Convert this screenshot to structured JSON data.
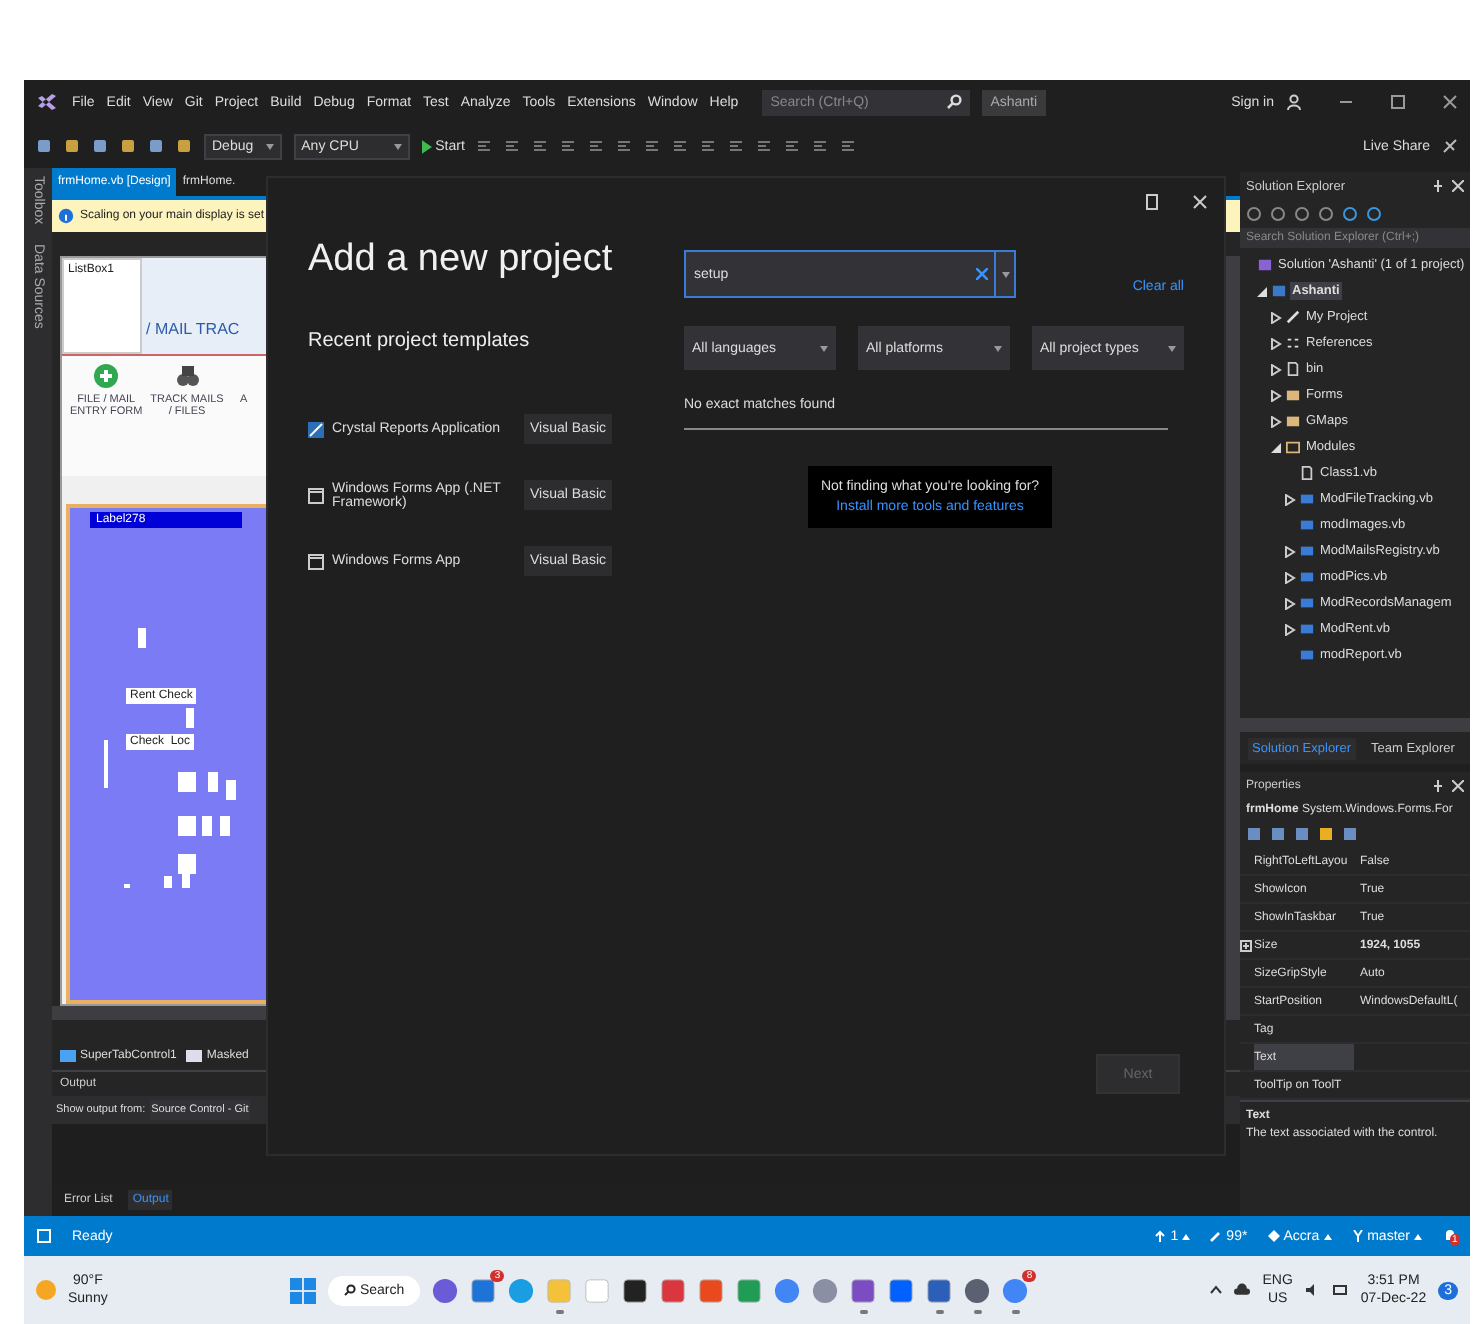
{
  "menu_bar": {
    "items": [
      "File",
      "Edit",
      "View",
      "Git",
      "Project",
      "Build",
      "Debug",
      "Format",
      "Test",
      "Analyze",
      "Tools",
      "Extensions",
      "Window",
      "Help"
    ],
    "search": {
      "placeholder": "Search (Ctrl+Q)"
    },
    "solution_name": "Ashanti",
    "sign_in": "Sign in"
  },
  "toolbar": {
    "configuration": "Debug",
    "platform": "Any CPU",
    "start": "Start",
    "live_share": "Live Share"
  },
  "side_tabs": [
    "Toolbox",
    "Data Sources"
  ],
  "document_tabs": [
    {
      "label": "frmHome.vb [Design]",
      "selected": true
    },
    {
      "label": "frmHome.",
      "selected": false
    }
  ],
  "info_bar": "Scaling on your main display is set",
  "designer": {
    "listbox": "ListBox1",
    "banner": "/ MAIL TRAC",
    "ribbon": [
      {
        "label": "FILE / MAIL\nENTRY FORM",
        "kind": "plus"
      },
      {
        "label": "TRACK MAILS\n/ FILES",
        "kind": "binoculars"
      },
      {
        "label": "A",
        "kind": "none"
      }
    ],
    "label": "Label278",
    "buttons": [
      "Rent Check",
      "Check  Loc"
    ]
  },
  "component_tray": [
    {
      "label": "SuperTabControl1",
      "kind": "tab"
    },
    {
      "label": "Masked",
      "kind": "masked"
    }
  ],
  "output": {
    "title": "Output",
    "show_from_label": "Show output from:",
    "source": "Source Control - Git",
    "tabs": [
      {
        "label": "Error List",
        "selected": false
      },
      {
        "label": "Output",
        "selected": true
      }
    ]
  },
  "dialog": {
    "title": "Add a new project",
    "recent_heading": "Recent project templates",
    "templates": [
      {
        "name": "Crystal Reports Application",
        "language": "Visual Basic",
        "kind": "crystal"
      },
      {
        "name": "Windows Forms App (.NET Framework)",
        "language": "Visual Basic",
        "kind": "window"
      },
      {
        "name": "Windows Forms App",
        "language": "Visual Basic",
        "kind": "window"
      }
    ],
    "search": {
      "value": "setup"
    },
    "clear_all": "Clear all",
    "filters": [
      "All languages",
      "All platforms",
      "All project types"
    ],
    "result_message": "No exact matches found",
    "hint": {
      "question": "Not finding what you're looking for?",
      "link": "Install more tools and features"
    },
    "next_button": {
      "label": "Next",
      "disabled": true
    }
  },
  "solution_explorer": {
    "title": "Solution Explorer",
    "search": {
      "placeholder": "Search Solution Explorer (Ctrl+;)"
    },
    "tree": [
      {
        "label": "Solution 'Ashanti' (1 of 1 project)",
        "kind": "solution",
        "selected": false,
        "children": [
          {
            "label": "Ashanti",
            "kind": "project",
            "expanded": true,
            "selected": true,
            "children": [
              {
                "label": "My Project",
                "kind": "wrench",
                "expanded": false,
                "selected": false
              },
              {
                "label": "References",
                "kind": "references",
                "expanded": false,
                "selected": false
              },
              {
                "label": "bin",
                "kind": "file",
                "expanded": false,
                "selected": false
              },
              {
                "label": "Forms",
                "kind": "folder",
                "expanded": false,
                "selected": false
              },
              {
                "label": "GMaps",
                "kind": "folder",
                "expanded": false,
                "selected": false
              },
              {
                "label": "Modules",
                "kind": "folder-open",
                "expanded": true,
                "selected": false,
                "children": [
                  {
                    "label": "Class1.vb",
                    "kind": "file",
                    "selected": false
                  },
                  {
                    "label": "ModFileTracking.vb",
                    "kind": "vb",
                    "expanded": false,
                    "selected": false
                  },
                  {
                    "label": "modImages.vb",
                    "kind": "vb",
                    "selected": false
                  },
                  {
                    "label": "ModMailsRegistry.vb",
                    "kind": "vb",
                    "expanded": false,
                    "selected": false
                  },
                  {
                    "label": "modPics.vb",
                    "kind": "vb",
                    "expanded": false,
                    "selected": false
                  },
                  {
                    "label": "ModRecordsManagem",
                    "kind": "vb",
                    "expanded": false,
                    "selected": false
                  },
                  {
                    "label": "ModRent.vb",
                    "kind": "vb",
                    "expanded": false,
                    "selected": false
                  },
                  {
                    "label": "modReport.vb",
                    "kind": "vb",
                    "selected": false
                  }
                ]
              }
            ]
          }
        ]
      }
    ],
    "tabs": [
      {
        "label": "Solution Explorer",
        "selected": true
      },
      {
        "label": "Team Explorer",
        "selected": false
      }
    ]
  },
  "properties": {
    "title": "Properties",
    "object_name": "frmHome",
    "object_type": "System.Windows.Forms.For",
    "rows": [
      {
        "name": "RightToLeftLayou",
        "value": "False",
        "kind": "plain",
        "selected": false
      },
      {
        "name": "ShowIcon",
        "value": "True",
        "kind": "plain",
        "selected": false
      },
      {
        "name": "ShowInTaskbar",
        "value": "True",
        "kind": "plain",
        "selected": false
      },
      {
        "name": "Size",
        "value": "1924, 1055",
        "kind": "group",
        "selected": false
      },
      {
        "name": "SizeGripStyle",
        "value": "Auto",
        "kind": "plain",
        "selected": false
      },
      {
        "name": "StartPosition",
        "value": "WindowsDefaultL(",
        "kind": "plain",
        "selected": false
      },
      {
        "name": "Tag",
        "kind": "plain",
        "selected": false
      },
      {
        "name": "Text",
        "kind": "plain",
        "selected": true
      },
      {
        "name": "ToolTip on ToolT",
        "kind": "plain",
        "selected": false
      }
    ],
    "description_title": "Text",
    "description": "The text associated with the control."
  },
  "status_bar": {
    "ready": "Ready",
    "up": "1",
    "edits": "99*",
    "location": "Accra",
    "branch": "master",
    "notifications": "1"
  },
  "taskbar": {
    "weather": {
      "temp": "90°F",
      "condition": "Sunny"
    },
    "search": "Search",
    "apps": [
      {
        "kind": "meet",
        "running": false
      },
      {
        "kind": "mail",
        "badge": "3",
        "running": false
      },
      {
        "kind": "edge",
        "running": false
      },
      {
        "kind": "folder",
        "running": true
      },
      {
        "kind": "amazon",
        "running": false
      },
      {
        "kind": "bolt",
        "running": false
      },
      {
        "kind": "reader",
        "running": false
      },
      {
        "kind": "office",
        "running": false
      },
      {
        "kind": "excel",
        "running": false
      },
      {
        "kind": "chrome",
        "running": false
      },
      {
        "kind": "camera",
        "running": false
      },
      {
        "kind": "vs",
        "running": true
      },
      {
        "kind": "dropbox",
        "running": false
      },
      {
        "kind": "word",
        "running": true
      },
      {
        "kind": "gear",
        "running": true
      },
      {
        "kind": "chrome",
        "badge": "8",
        "running": true
      }
    ],
    "language": "ENG",
    "region": "US",
    "time": "3:51 PM",
    "date": "07-Dec-22",
    "notification_count": "3"
  }
}
